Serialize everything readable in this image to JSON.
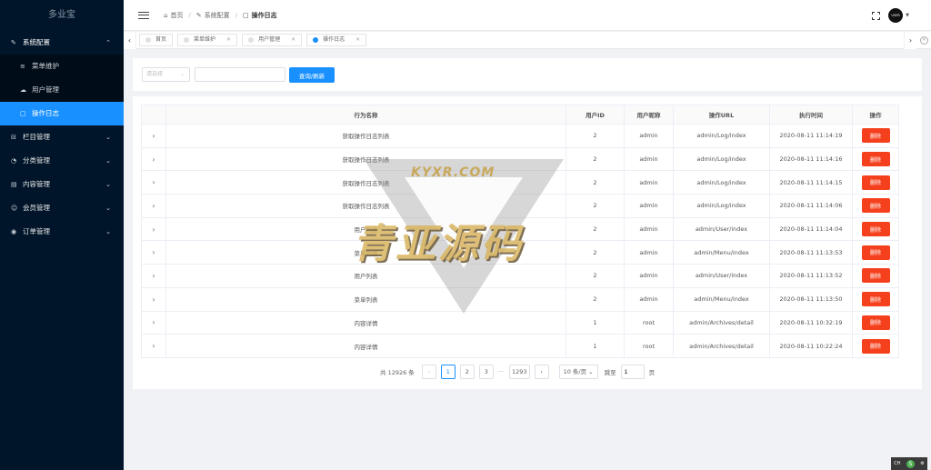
{
  "sidebar": {
    "logo": "多业宝",
    "menu": [
      {
        "label": "系统配置",
        "icon": "wrench-icon",
        "glyph": "✎",
        "open": true,
        "children": [
          {
            "label": "菜单维护",
            "icon": "list-icon",
            "glyph": "≡"
          },
          {
            "label": "用户管理",
            "icon": "users-icon",
            "glyph": "☁"
          },
          {
            "label": "操作日志",
            "icon": "log-icon",
            "glyph": "▢",
            "active": true
          }
        ]
      },
      {
        "label": "栏目管理",
        "icon": "columns-icon",
        "glyph": "⊟"
      },
      {
        "label": "分类管理",
        "icon": "category-icon",
        "glyph": "◔"
      },
      {
        "label": "内容管理",
        "icon": "content-icon",
        "glyph": "▤"
      },
      {
        "label": "会员管理",
        "icon": "member-icon",
        "glyph": "☺"
      },
      {
        "label": "订单管理",
        "icon": "order-icon",
        "glyph": "◉"
      }
    ]
  },
  "header": {
    "breadcrumb": [
      {
        "label": "首页",
        "glyph": "⌂"
      },
      {
        "label": "系统配置",
        "glyph": "✎"
      },
      {
        "label": "操作日志",
        "glyph": "▢"
      }
    ],
    "avatar_text": "USER"
  },
  "tabs": [
    {
      "label": "首页",
      "closable": false
    },
    {
      "label": "菜单维护",
      "closable": true
    },
    {
      "label": "用户管理",
      "closable": true
    },
    {
      "label": "操作日志",
      "closable": true,
      "active": true
    }
  ],
  "search": {
    "select_placeholder": "请选择",
    "input_value": "",
    "button_label": "查询/刷新"
  },
  "table": {
    "columns": [
      "",
      "行为名称",
      "用户ID",
      "用户昵称",
      "操作URL",
      "执行时间",
      "操作"
    ],
    "delete_label": "删除",
    "rows": [
      {
        "name": "获取操作日志列表",
        "uid": "2",
        "nick": "admin",
        "url": "admin/Log/index",
        "time": "2020-08-11 11:14:19"
      },
      {
        "name": "获取操作日志列表",
        "uid": "2",
        "nick": "admin",
        "url": "admin/Log/index",
        "time": "2020-08-11 11:14:16"
      },
      {
        "name": "获取操作日志列表",
        "uid": "2",
        "nick": "admin",
        "url": "admin/Log/index",
        "time": "2020-08-11 11:14:15"
      },
      {
        "name": "获取操作日志列表",
        "uid": "2",
        "nick": "admin",
        "url": "admin/Log/index",
        "time": "2020-08-11 11:14:06"
      },
      {
        "name": "用户列表",
        "uid": "2",
        "nick": "admin",
        "url": "admin/User/index",
        "time": "2020-08-11 11:14:04"
      },
      {
        "name": "菜单列表",
        "uid": "2",
        "nick": "admin",
        "url": "admin/Menu/index",
        "time": "2020-08-11 11:13:53"
      },
      {
        "name": "用户列表",
        "uid": "2",
        "nick": "admin",
        "url": "admin/User/index",
        "time": "2020-08-11 11:13:52"
      },
      {
        "name": "菜单列表",
        "uid": "2",
        "nick": "admin",
        "url": "admin/Menu/index",
        "time": "2020-08-11 11:13:50"
      },
      {
        "name": "内容详情",
        "uid": "1",
        "nick": "root",
        "url": "admin/Archives/detail",
        "time": "2020-08-11 10:32:19"
      },
      {
        "name": "内容详情",
        "uid": "1",
        "nick": "root",
        "url": "admin/Archives/detail",
        "time": "2020-08-11 10:22:24"
      }
    ]
  },
  "pagination": {
    "total": "共 12926 条",
    "pages": [
      "1",
      "2",
      "3"
    ],
    "ellipsis": "···",
    "last_page": "1293",
    "page_size": "10 条/页",
    "goto_label": "跳至",
    "goto_value": "1",
    "page_unit": "页"
  },
  "watermark": {
    "top": "KYXR.COM",
    "main": "青亚源码"
  },
  "tray": {
    "label": "CH"
  }
}
